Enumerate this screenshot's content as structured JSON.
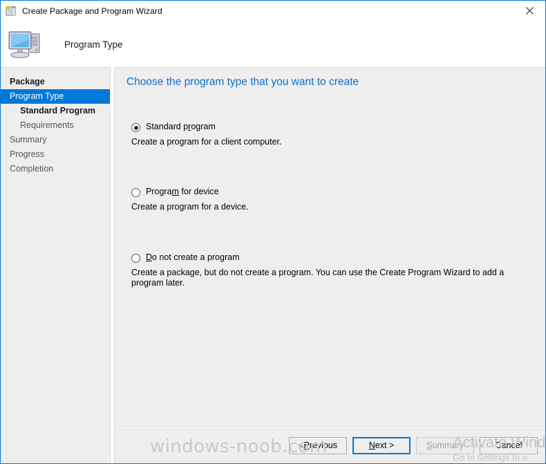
{
  "window": {
    "title": "Create Package and Program Wizard",
    "title_icon": "wizard-package-icon",
    "close_label": "✕",
    "accent_color": "#0078d7",
    "panel_color": "#eeeeee"
  },
  "header": {
    "title": "Program Type",
    "icon": "computer-monitor-icon"
  },
  "sidebar": {
    "items": [
      {
        "label": "Package",
        "level": 1,
        "state": "visited"
      },
      {
        "label": "Program Type",
        "level": 1,
        "state": "active"
      },
      {
        "label": "Standard Program",
        "level": 2,
        "state": "visited"
      },
      {
        "label": "Requirements",
        "level": 2,
        "state": "pending"
      },
      {
        "label": "Summary",
        "level": 1,
        "state": "pending"
      },
      {
        "label": "Progress",
        "level": 1,
        "state": "pending"
      },
      {
        "label": "Completion",
        "level": 1,
        "state": "pending"
      }
    ]
  },
  "main": {
    "heading": "Choose the program type that you want to create",
    "options": [
      {
        "label_before": "Standard p",
        "label_accel": "r",
        "label_after": "ogram",
        "description": "Create a program for a client computer.",
        "selected": true
      },
      {
        "label_before": "Progra",
        "label_accel": "m",
        "label_after": " for device",
        "description": "Create a program for a device.",
        "selected": false
      },
      {
        "label_before": "",
        "label_accel": "D",
        "label_after": "o not create a program",
        "description": "Create a package, but do not create a program. You can use the Create Program Wizard to add a program later.",
        "selected": false
      }
    ]
  },
  "footer": {
    "buttons": [
      {
        "before": "< ",
        "accel": "P",
        "after": "revious",
        "state": "enabled",
        "default": false
      },
      {
        "before": "",
        "accel": "N",
        "after": "ext >",
        "state": "enabled",
        "default": true
      },
      {
        "before": "",
        "accel": "S",
        "after": "ummary",
        "state": "disabled",
        "default": false
      },
      {
        "before": "",
        "accel": "",
        "after": "Cancel",
        "state": "enabled",
        "default": false
      }
    ]
  },
  "watermarks": {
    "site": "windows-noob.com",
    "activate_line1": "Activate Wind",
    "activate_line2": "Go to Settings to a"
  }
}
